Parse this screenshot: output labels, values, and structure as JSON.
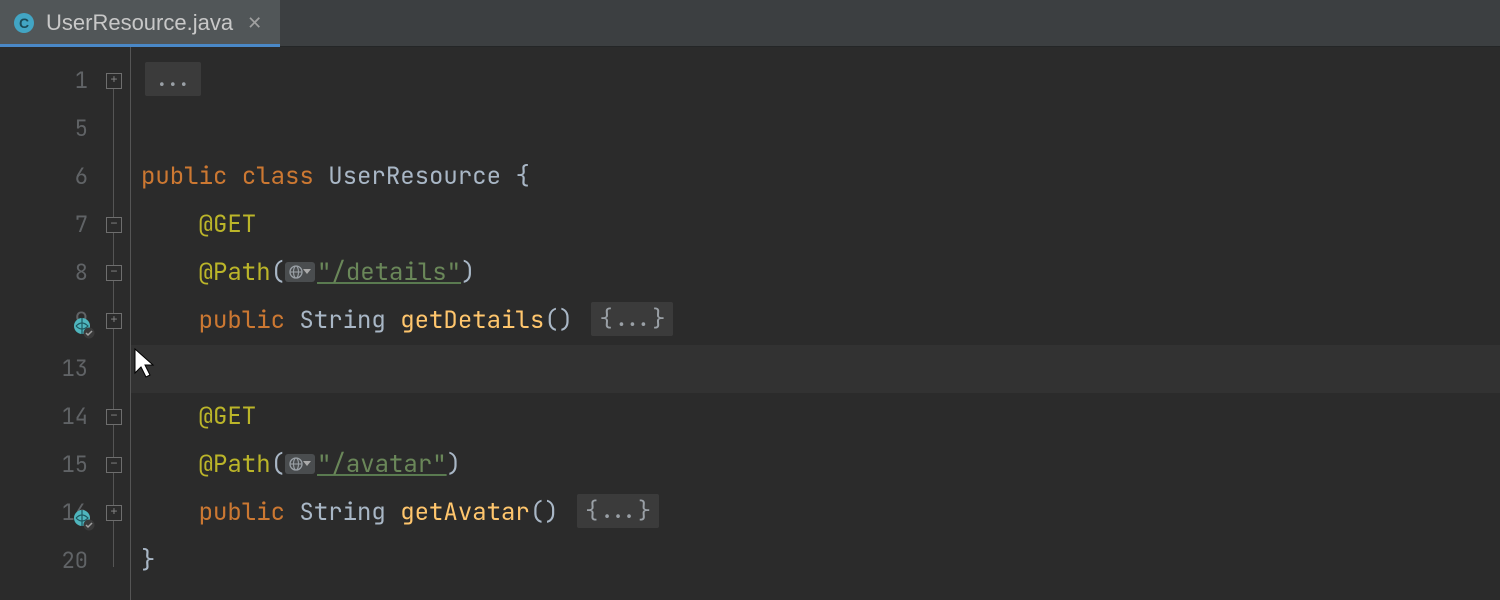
{
  "tab": {
    "icon_letter": "C",
    "title": "UserResource.java"
  },
  "lines": [
    {
      "num": "1"
    },
    {
      "num": "5"
    },
    {
      "num": "6"
    },
    {
      "num": "7"
    },
    {
      "num": "8"
    },
    {
      "num": "9"
    },
    {
      "num": "13"
    },
    {
      "num": "14"
    },
    {
      "num": "15"
    },
    {
      "num": "16"
    },
    {
      "num": "20"
    }
  ],
  "code": {
    "kw_public": "public",
    "kw_class": "class",
    "class_name": "UserResource",
    "open_brace": "{",
    "close_brace": "}",
    "ann_get": "@GET",
    "ann_path": "@Path",
    "paren_open": "(",
    "paren_close": ")",
    "paren_pair": "()",
    "path1": "\"/details\"",
    "path2": "\"/avatar\"",
    "type_string": "String",
    "method1": "getDetails",
    "method2": "getAvatar",
    "folded_body": "{...}",
    "folded_top": "..."
  }
}
